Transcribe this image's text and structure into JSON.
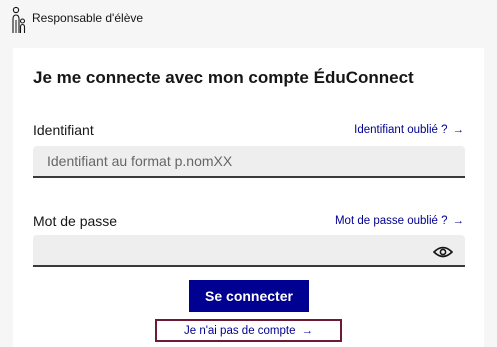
{
  "header": {
    "role_label": "Responsable d'élève",
    "role_icon": "parent-child-icon"
  },
  "login": {
    "title": "Je me connecte avec mon compte ÉduConnect",
    "identifier": {
      "label": "Identifiant",
      "forgot_link": "Identifiant oublié ?",
      "placeholder": "Identifiant au format p.nomXX",
      "value": ""
    },
    "password": {
      "label": "Mot de passe",
      "forgot_link": "Mot de passe oublié ?",
      "value": "",
      "toggle_icon": "eye-icon"
    },
    "submit_label": "Se connecter",
    "no_account_link": "Je n'ai pas de compte"
  },
  "colors": {
    "primary": "#000091",
    "focus_border": "#6e1a35",
    "page_background": "#f6f6f6"
  }
}
